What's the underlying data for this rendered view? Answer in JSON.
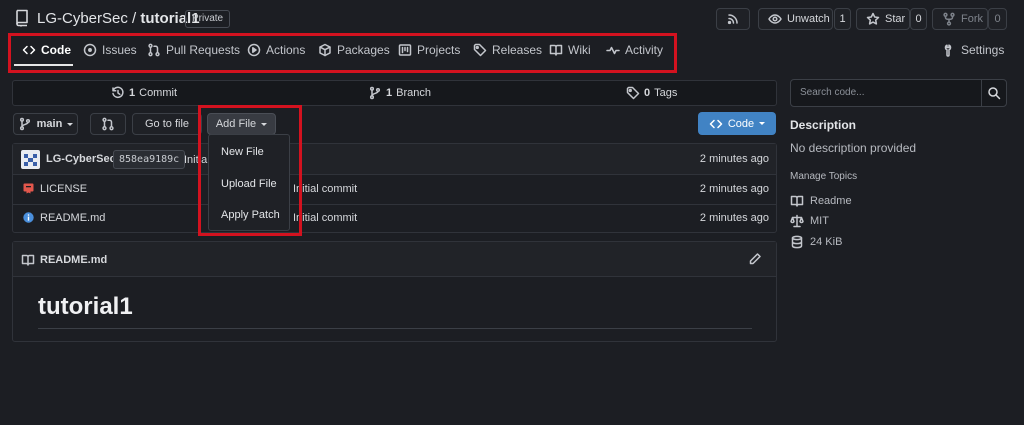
{
  "header": {
    "owner": "LG-CyberSec",
    "separator": " / ",
    "repo": "tutorial1",
    "visibility": "Private",
    "rss_icon": "rss-icon",
    "unwatch_label": "Unwatch",
    "unwatch_count": "1",
    "star_label": "Star",
    "star_count": "0",
    "fork_label": "Fork",
    "fork_count": "0"
  },
  "nav": {
    "tabs": [
      {
        "label": "Code",
        "icon": "code-icon"
      },
      {
        "label": "Issues",
        "icon": "issue-icon"
      },
      {
        "label": "Pull Requests",
        "icon": "pull-request-icon"
      },
      {
        "label": "Actions",
        "icon": "play-icon"
      },
      {
        "label": "Packages",
        "icon": "package-icon"
      },
      {
        "label": "Projects",
        "icon": "project-icon"
      },
      {
        "label": "Releases",
        "icon": "tag-icon"
      },
      {
        "label": "Wiki",
        "icon": "book-icon"
      },
      {
        "label": "Activity",
        "icon": "pulse-icon"
      }
    ],
    "settings_label": "Settings",
    "active": "Code",
    "highlight_color": "#d3121f"
  },
  "stats": {
    "commits_count": "1",
    "commits_label": "Commit",
    "branches_count": "1",
    "branches_label": "Branch",
    "tags_count": "0",
    "tags_label": "Tags"
  },
  "toolbar": {
    "branch": "main",
    "go_to_file": "Go to file",
    "add_file": "Add File",
    "code_label": "Code",
    "code_color": "#4183c4"
  },
  "add_file_menu": {
    "items": [
      "New File",
      "Upload File",
      "Apply Patch"
    ]
  },
  "files": {
    "latest_commit": {
      "author": "LG-CyberSec",
      "sha": "858ea9189c",
      "message": "Initial commit",
      "message_visible": "Initia",
      "time": "2 minutes ago"
    },
    "rows": [
      {
        "name": "LICENSE",
        "icon": "license-icon",
        "message": "Initial commit",
        "time": "2 minutes ago"
      },
      {
        "name": "README.md",
        "icon": "info-icon",
        "message": "Initial commit",
        "time": "2 minutes ago"
      }
    ]
  },
  "readme": {
    "filename": "README.md",
    "heading": "tutorial1"
  },
  "sidebar": {
    "search_placeholder": "Search code...",
    "description_title": "Description",
    "description_text": "No description provided",
    "manage_topics": "Manage Topics",
    "readme_label": "Readme",
    "license_label": "MIT",
    "size_label": "24 KiB"
  }
}
